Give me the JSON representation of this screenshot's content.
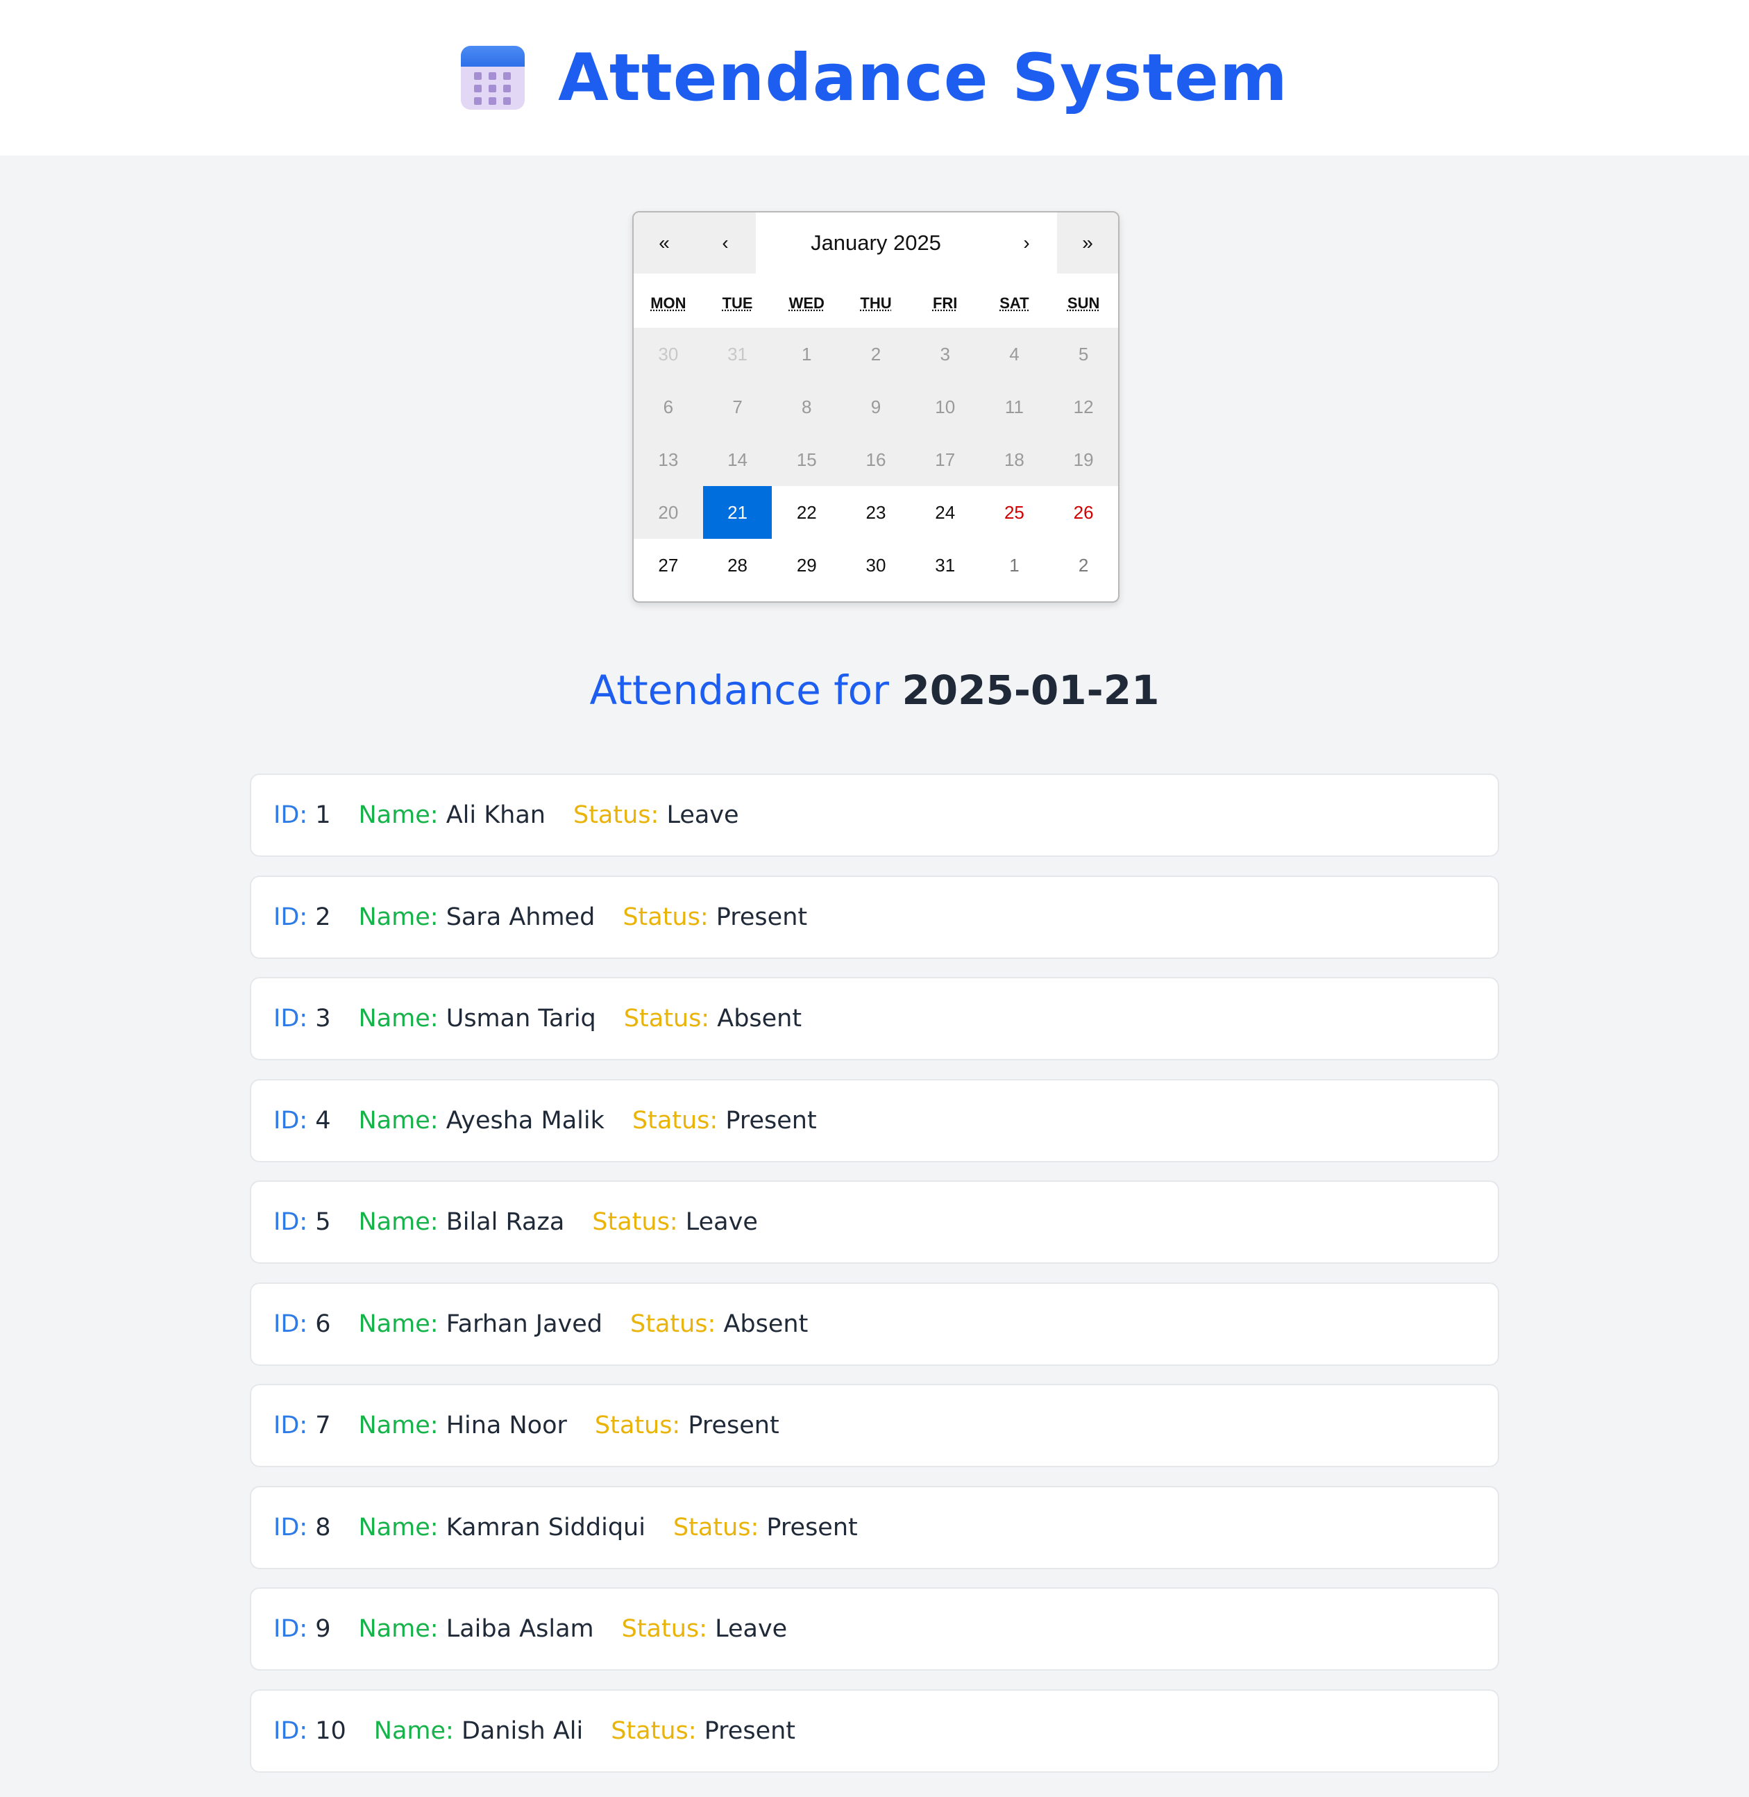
{
  "header": {
    "title": "Attendance System",
    "icon": "calendar-icon"
  },
  "calendar": {
    "nav": {
      "prev_year": "«",
      "prev_month": "‹",
      "label": "January 2025",
      "next_month": "›",
      "next_year": "»"
    },
    "weekdays": [
      "MON",
      "TUE",
      "WED",
      "THU",
      "FRI",
      "SAT",
      "SUN"
    ],
    "days": [
      {
        "n": "30",
        "cls": "past neighbor"
      },
      {
        "n": "31",
        "cls": "past neighbor"
      },
      {
        "n": "1",
        "cls": "past"
      },
      {
        "n": "2",
        "cls": "past"
      },
      {
        "n": "3",
        "cls": "past"
      },
      {
        "n": "4",
        "cls": "past"
      },
      {
        "n": "5",
        "cls": "past"
      },
      {
        "n": "6",
        "cls": "past"
      },
      {
        "n": "7",
        "cls": "past"
      },
      {
        "n": "8",
        "cls": "past"
      },
      {
        "n": "9",
        "cls": "past"
      },
      {
        "n": "10",
        "cls": "past"
      },
      {
        "n": "11",
        "cls": "past"
      },
      {
        "n": "12",
        "cls": "past"
      },
      {
        "n": "13",
        "cls": "past"
      },
      {
        "n": "14",
        "cls": "past"
      },
      {
        "n": "15",
        "cls": "past"
      },
      {
        "n": "16",
        "cls": "past"
      },
      {
        "n": "17",
        "cls": "past"
      },
      {
        "n": "18",
        "cls": "past"
      },
      {
        "n": "19",
        "cls": "past"
      },
      {
        "n": "20",
        "cls": "past"
      },
      {
        "n": "21",
        "cls": "selected"
      },
      {
        "n": "22",
        "cls": ""
      },
      {
        "n": "23",
        "cls": ""
      },
      {
        "n": "24",
        "cls": ""
      },
      {
        "n": "25",
        "cls": "weekend"
      },
      {
        "n": "26",
        "cls": "weekend"
      },
      {
        "n": "27",
        "cls": ""
      },
      {
        "n": "28",
        "cls": ""
      },
      {
        "n": "29",
        "cls": ""
      },
      {
        "n": "30",
        "cls": ""
      },
      {
        "n": "31",
        "cls": ""
      },
      {
        "n": "1",
        "cls": "neighbor"
      },
      {
        "n": "2",
        "cls": "neighbor"
      }
    ],
    "selected_date": "21"
  },
  "attendance": {
    "heading_label": "Attendance for",
    "heading_date": "2025-01-21",
    "labels": {
      "id": "ID:",
      "name": "Name:",
      "status": "Status:"
    },
    "records": [
      {
        "id": "1",
        "name": "Ali Khan",
        "status": "Leave"
      },
      {
        "id": "2",
        "name": "Sara Ahmed",
        "status": "Present"
      },
      {
        "id": "3",
        "name": "Usman Tariq",
        "status": "Absent"
      },
      {
        "id": "4",
        "name": "Ayesha Malik",
        "status": "Present"
      },
      {
        "id": "5",
        "name": "Bilal Raza",
        "status": "Leave"
      },
      {
        "id": "6",
        "name": "Farhan Javed",
        "status": "Absent"
      },
      {
        "id": "7",
        "name": "Hina Noor",
        "status": "Present"
      },
      {
        "id": "8",
        "name": "Kamran Siddiqui",
        "status": "Present"
      },
      {
        "id": "9",
        "name": "Laiba Aslam",
        "status": "Leave"
      },
      {
        "id": "10",
        "name": "Danish Ali",
        "status": "Present"
      }
    ]
  },
  "colors": {
    "accent": "#1d5ef0",
    "selected_day": "#006edc",
    "weekend": "#d10000",
    "id_label": "#2f7be6",
    "name_label": "#16b34a",
    "status_label": "#eab308"
  }
}
